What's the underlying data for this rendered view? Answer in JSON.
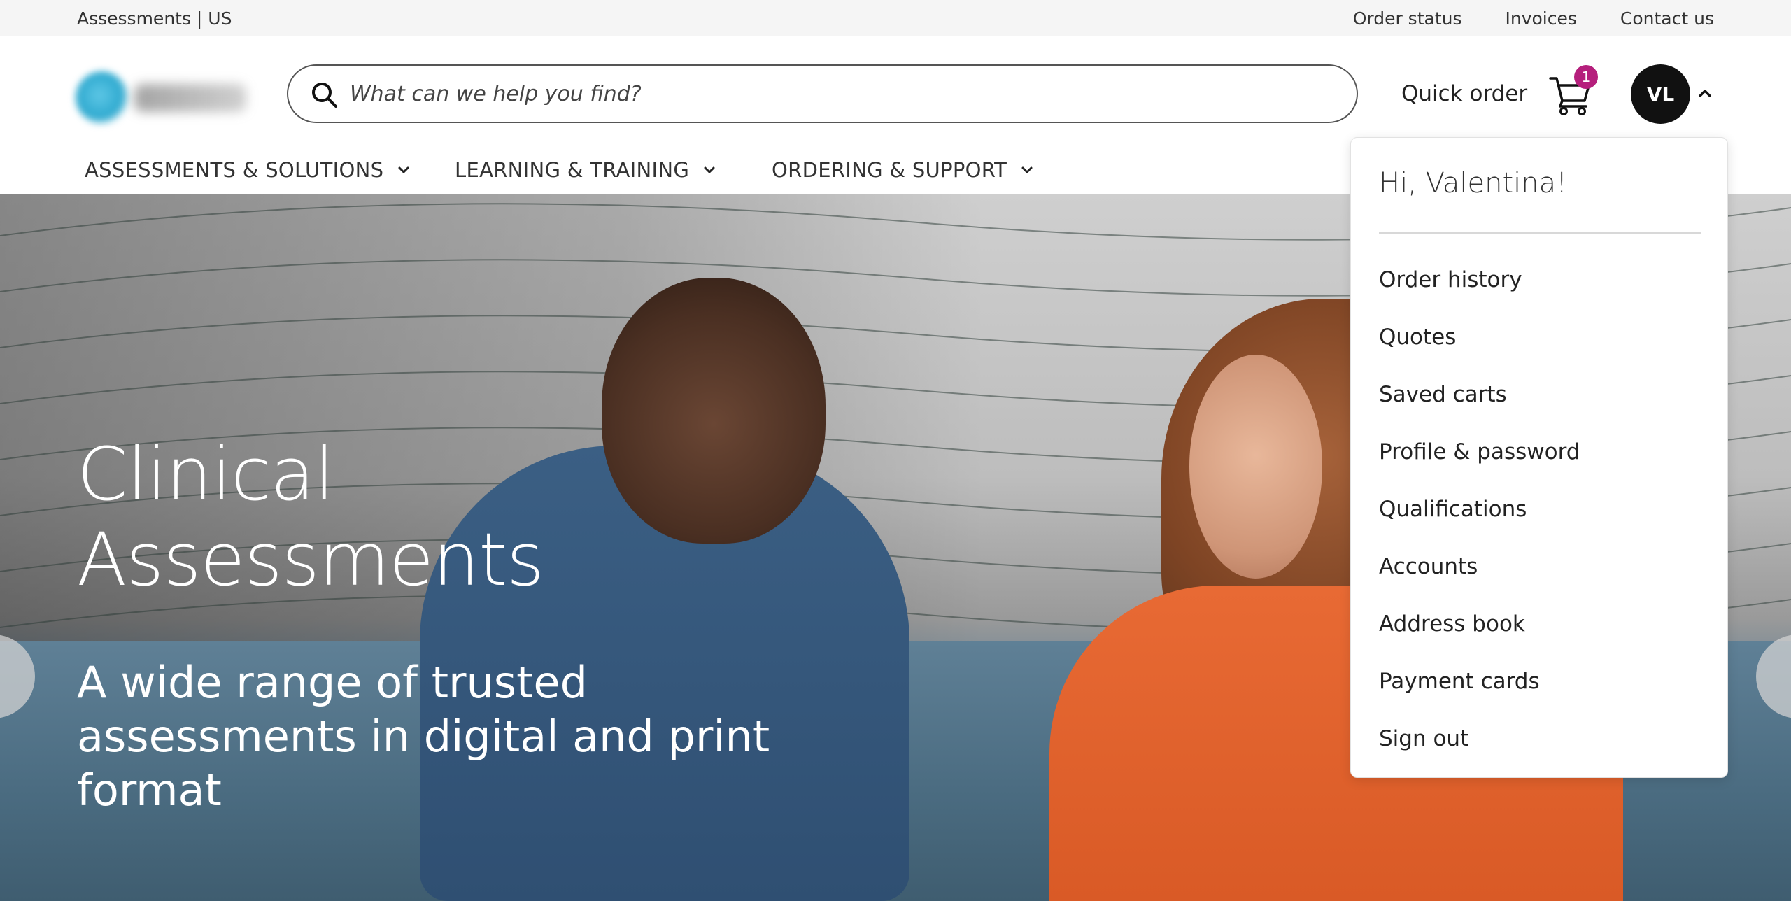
{
  "utility_bar": {
    "left_text": "Assessments | US",
    "links": [
      "Order status",
      "Invoices",
      "Contact us"
    ]
  },
  "header": {
    "search": {
      "placeholder": "What can we help you find?",
      "value": ""
    },
    "quick_order_label": "Quick order",
    "cart_count": "1",
    "avatar_initials": "VL"
  },
  "nav": {
    "items": [
      {
        "label": "ASSESSMENTS & SOLUTIONS"
      },
      {
        "label": "LEARNING & TRAINING"
      },
      {
        "label": "ORDERING & SUPPORT"
      }
    ]
  },
  "hero": {
    "title_line1": "Clinical",
    "title_line2": "Assessments",
    "subtitle": "A wide range of trusted assessments in digital and print format"
  },
  "account_menu": {
    "greeting": "Hi, Valentina!",
    "items": [
      "Order history",
      "Quotes",
      "Saved carts",
      "Profile & password",
      "Qualifications",
      "Accounts",
      "Address book",
      "Payment cards",
      "Sign out"
    ]
  },
  "colors": {
    "badge": "#b51f7c",
    "avatar_bg": "#111111",
    "utility_bg": "#f5f5f5"
  },
  "icons": {
    "search": "search-icon",
    "cart": "cart-icon",
    "nav_chevron": "chevron-down-icon",
    "avatar_chevron": "chevron-up-icon"
  }
}
